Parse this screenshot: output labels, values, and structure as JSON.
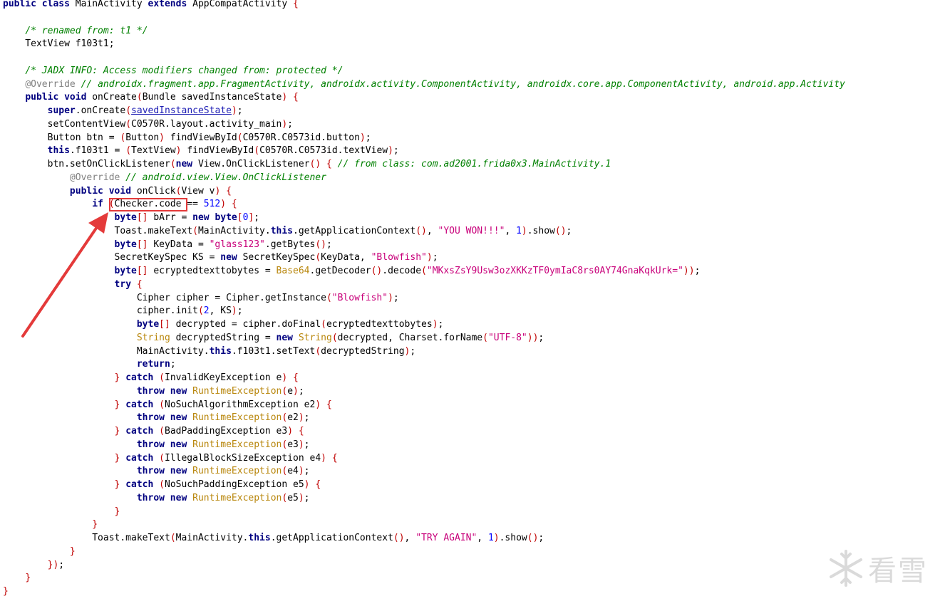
{
  "code_lines": [
    [
      [
        "kw",
        "public class "
      ],
      [
        "",
        "MainActivity "
      ],
      [
        "kw",
        "extends "
      ],
      [
        "",
        "AppCompatActivity "
      ],
      [
        "br",
        "{"
      ]
    ],
    [],
    [
      [
        "",
        "    "
      ],
      [
        "cm",
        "/* renamed from: t1 */"
      ]
    ],
    [
      [
        "",
        "    TextView f103t1;"
      ]
    ],
    [],
    [
      [
        "",
        "    "
      ],
      [
        "cm",
        "/* JADX INFO: Access modifiers changed from: protected */"
      ]
    ],
    [
      [
        "",
        "    "
      ],
      [
        "an",
        "@Override "
      ],
      [
        "cm",
        "// androidx.fragment.app.FragmentActivity, androidx.activity.ComponentActivity, androidx.core.app.ComponentActivity, android.app.Activity"
      ]
    ],
    [
      [
        "",
        "    "
      ],
      [
        "kw",
        "public void "
      ],
      [
        "",
        "onCreate"
      ],
      [
        "br",
        "("
      ],
      [
        "",
        "Bundle savedInstanceState"
      ],
      [
        "br",
        ")"
      ],
      [
        "",
        " "
      ],
      [
        "br",
        "{"
      ]
    ],
    [
      [
        "",
        "        "
      ],
      [
        "kw",
        "super"
      ],
      [
        "",
        ".onCreate"
      ],
      [
        "br",
        "("
      ],
      [
        "lk",
        "savedInstanceState"
      ],
      [
        "br",
        ")"
      ],
      [
        "",
        ";"
      ]
    ],
    [
      [
        "",
        "        setContentView"
      ],
      [
        "br",
        "("
      ],
      [
        "",
        "C0570R.layout.activity_main"
      ],
      [
        "br",
        ")"
      ],
      [
        "",
        ";"
      ]
    ],
    [
      [
        "",
        "        Button btn = "
      ],
      [
        "br",
        "("
      ],
      [
        "",
        "Button"
      ],
      [
        "br",
        ")"
      ],
      [
        "",
        " findViewById"
      ],
      [
        "br",
        "("
      ],
      [
        "",
        "C0570R.C0573id.button"
      ],
      [
        "br",
        ")"
      ],
      [
        "",
        ";"
      ]
    ],
    [
      [
        "",
        "        "
      ],
      [
        "kw",
        "this"
      ],
      [
        "",
        ".f103t1 = "
      ],
      [
        "br",
        "("
      ],
      [
        "",
        "TextView"
      ],
      [
        "br",
        ")"
      ],
      [
        "",
        " findViewById"
      ],
      [
        "br",
        "("
      ],
      [
        "",
        "C0570R.C0573id.textView"
      ],
      [
        "br",
        ")"
      ],
      [
        "",
        ";"
      ]
    ],
    [
      [
        "",
        "        btn.setOnClickListener"
      ],
      [
        "br",
        "("
      ],
      [
        "kw",
        "new "
      ],
      [
        "",
        "View.OnClickListener"
      ],
      [
        "br",
        "()"
      ],
      [
        "",
        " "
      ],
      [
        "br",
        "{"
      ],
      [
        "",
        " "
      ],
      [
        "cm",
        "// from class: com.ad2001.frida0x3.MainActivity.1"
      ]
    ],
    [
      [
        "",
        "            "
      ],
      [
        "an",
        "@Override "
      ],
      [
        "cm",
        "// android.view.View.OnClickListener"
      ]
    ],
    [
      [
        "",
        "            "
      ],
      [
        "kw",
        "public void "
      ],
      [
        "",
        "onClick"
      ],
      [
        "br",
        "("
      ],
      [
        "",
        "View v"
      ],
      [
        "br",
        ")"
      ],
      [
        "",
        " "
      ],
      [
        "br",
        "{"
      ]
    ],
    [
      [
        "",
        "                "
      ],
      [
        "kw",
        "if "
      ],
      [
        "br",
        "("
      ],
      [
        "",
        "Checker.code == "
      ],
      [
        "nm",
        "512"
      ],
      [
        "br",
        ")"
      ],
      [
        "",
        " "
      ],
      [
        "br",
        "{"
      ]
    ],
    [
      [
        "",
        "                    "
      ],
      [
        "kw",
        "byte"
      ],
      [
        "br",
        "[]"
      ],
      [
        "",
        " bArr = "
      ],
      [
        "kw",
        "new byte"
      ],
      [
        "br",
        "["
      ],
      [
        "nm",
        "0"
      ],
      [
        "br",
        "]"
      ],
      [
        "",
        ";"
      ]
    ],
    [
      [
        "",
        "                    Toast.makeText"
      ],
      [
        "br",
        "("
      ],
      [
        "",
        "MainActivity."
      ],
      [
        "kw",
        "this"
      ],
      [
        "",
        ".getApplicationContext"
      ],
      [
        "br",
        "()"
      ],
      [
        "",
        ", "
      ],
      [
        "st",
        "\"YOU WON!!!\""
      ],
      [
        "",
        ", "
      ],
      [
        "nm",
        "1"
      ],
      [
        "br",
        ")"
      ],
      [
        "",
        ".show"
      ],
      [
        "br",
        "()"
      ],
      [
        "",
        ";"
      ]
    ],
    [
      [
        "",
        "                    "
      ],
      [
        "kw",
        "byte"
      ],
      [
        "br",
        "[]"
      ],
      [
        "",
        " KeyData = "
      ],
      [
        "st",
        "\"glass123\""
      ],
      [
        "",
        ".getBytes"
      ],
      [
        "br",
        "()"
      ],
      [
        "",
        ";"
      ]
    ],
    [
      [
        "",
        "                    SecretKeySpec KS = "
      ],
      [
        "kw",
        "new "
      ],
      [
        "",
        "SecretKeySpec"
      ],
      [
        "br",
        "("
      ],
      [
        "",
        "KeyData, "
      ],
      [
        "st",
        "\"Blowfish\""
      ],
      [
        "br",
        ")"
      ],
      [
        "",
        ";"
      ]
    ],
    [
      [
        "",
        "                    "
      ],
      [
        "kw",
        "byte"
      ],
      [
        "br",
        "[]"
      ],
      [
        "",
        " ecryptedtexttobytes = "
      ],
      [
        "ty",
        "Base64"
      ],
      [
        "",
        ".getDecoder"
      ],
      [
        "br",
        "()"
      ],
      [
        "",
        ".decode"
      ],
      [
        "br",
        "("
      ],
      [
        "st",
        "\"MKxsZsY9Usw3ozXKKzTF0ymIaC8rs0AY74GnaKqkUrk=\""
      ],
      [
        "br",
        "))"
      ],
      [
        "",
        ";"
      ]
    ],
    [
      [
        "",
        "                    "
      ],
      [
        "kw",
        "try "
      ],
      [
        "br",
        "{"
      ]
    ],
    [
      [
        "",
        "                        Cipher cipher = Cipher.getInstance"
      ],
      [
        "br",
        "("
      ],
      [
        "st",
        "\"Blowfish\""
      ],
      [
        "br",
        ")"
      ],
      [
        "",
        ";"
      ]
    ],
    [
      [
        "",
        "                        cipher.init"
      ],
      [
        "br",
        "("
      ],
      [
        "nm",
        "2"
      ],
      [
        "",
        ", KS"
      ],
      [
        "br",
        ")"
      ],
      [
        "",
        ";"
      ]
    ],
    [
      [
        "",
        "                        "
      ],
      [
        "kw",
        "byte"
      ],
      [
        "br",
        "[]"
      ],
      [
        "",
        " decrypted = cipher.doFinal"
      ],
      [
        "br",
        "("
      ],
      [
        "",
        "ecryptedtexttobytes"
      ],
      [
        "br",
        ")"
      ],
      [
        "",
        ";"
      ]
    ],
    [
      [
        "",
        "                        "
      ],
      [
        "ty",
        "String"
      ],
      [
        "",
        " decryptedString = "
      ],
      [
        "kw",
        "new "
      ],
      [
        "ty",
        "String"
      ],
      [
        "br",
        "("
      ],
      [
        "",
        "decrypted, Charset.forName"
      ],
      [
        "br",
        "("
      ],
      [
        "st",
        "\"UTF-8\""
      ],
      [
        "br",
        "))"
      ],
      [
        "",
        ";"
      ]
    ],
    [
      [
        "",
        "                        MainActivity."
      ],
      [
        "kw",
        "this"
      ],
      [
        "",
        ".f103t1.setText"
      ],
      [
        "br",
        "("
      ],
      [
        "",
        "decryptedString"
      ],
      [
        "br",
        ")"
      ],
      [
        "",
        ";"
      ]
    ],
    [
      [
        "",
        "                        "
      ],
      [
        "kw",
        "return"
      ],
      [
        "",
        ";"
      ]
    ],
    [
      [
        "",
        "                    "
      ],
      [
        "br",
        "}"
      ],
      [
        "",
        " "
      ],
      [
        "kw",
        "catch "
      ],
      [
        "br",
        "("
      ],
      [
        "",
        "InvalidKeyException e"
      ],
      [
        "br",
        ")"
      ],
      [
        "",
        " "
      ],
      [
        "br",
        "{"
      ]
    ],
    [
      [
        "",
        "                        "
      ],
      [
        "kw",
        "throw new "
      ],
      [
        "ty",
        "RuntimeException"
      ],
      [
        "br",
        "("
      ],
      [
        "",
        "e"
      ],
      [
        "br",
        ")"
      ],
      [
        "",
        ";"
      ]
    ],
    [
      [
        "",
        "                    "
      ],
      [
        "br",
        "}"
      ],
      [
        "",
        " "
      ],
      [
        "kw",
        "catch "
      ],
      [
        "br",
        "("
      ],
      [
        "",
        "NoSuchAlgorithmException e2"
      ],
      [
        "br",
        ")"
      ],
      [
        "",
        " "
      ],
      [
        "br",
        "{"
      ]
    ],
    [
      [
        "",
        "                        "
      ],
      [
        "kw",
        "throw new "
      ],
      [
        "ty",
        "RuntimeException"
      ],
      [
        "br",
        "("
      ],
      [
        "",
        "e2"
      ],
      [
        "br",
        ")"
      ],
      [
        "",
        ";"
      ]
    ],
    [
      [
        "",
        "                    "
      ],
      [
        "br",
        "}"
      ],
      [
        "",
        " "
      ],
      [
        "kw",
        "catch "
      ],
      [
        "br",
        "("
      ],
      [
        "",
        "BadPaddingException e3"
      ],
      [
        "br",
        ")"
      ],
      [
        "",
        " "
      ],
      [
        "br",
        "{"
      ]
    ],
    [
      [
        "",
        "                        "
      ],
      [
        "kw",
        "throw new "
      ],
      [
        "ty",
        "RuntimeException"
      ],
      [
        "br",
        "("
      ],
      [
        "",
        "e3"
      ],
      [
        "br",
        ")"
      ],
      [
        "",
        ";"
      ]
    ],
    [
      [
        "",
        "                    "
      ],
      [
        "br",
        "}"
      ],
      [
        "",
        " "
      ],
      [
        "kw",
        "catch "
      ],
      [
        "br",
        "("
      ],
      [
        "",
        "IllegalBlockSizeException e4"
      ],
      [
        "br",
        ")"
      ],
      [
        "",
        " "
      ],
      [
        "br",
        "{"
      ]
    ],
    [
      [
        "",
        "                        "
      ],
      [
        "kw",
        "throw new "
      ],
      [
        "ty",
        "RuntimeException"
      ],
      [
        "br",
        "("
      ],
      [
        "",
        "e4"
      ],
      [
        "br",
        ")"
      ],
      [
        "",
        ";"
      ]
    ],
    [
      [
        "",
        "                    "
      ],
      [
        "br",
        "}"
      ],
      [
        "",
        " "
      ],
      [
        "kw",
        "catch "
      ],
      [
        "br",
        "("
      ],
      [
        "",
        "NoSuchPaddingException e5"
      ],
      [
        "br",
        ")"
      ],
      [
        "",
        " "
      ],
      [
        "br",
        "{"
      ]
    ],
    [
      [
        "",
        "                        "
      ],
      [
        "kw",
        "throw new "
      ],
      [
        "ty",
        "RuntimeException"
      ],
      [
        "br",
        "("
      ],
      [
        "",
        "e5"
      ],
      [
        "br",
        ")"
      ],
      [
        "",
        ";"
      ]
    ],
    [
      [
        "",
        "                    "
      ],
      [
        "br",
        "}"
      ]
    ],
    [
      [
        "",
        "                "
      ],
      [
        "br",
        "}"
      ]
    ],
    [
      [
        "",
        "                Toast.makeText"
      ],
      [
        "br",
        "("
      ],
      [
        "",
        "MainActivity."
      ],
      [
        "kw",
        "this"
      ],
      [
        "",
        ".getApplicationContext"
      ],
      [
        "br",
        "()"
      ],
      [
        "",
        ", "
      ],
      [
        "st",
        "\"TRY AGAIN\""
      ],
      [
        "",
        ", "
      ],
      [
        "nm",
        "1"
      ],
      [
        "br",
        ")"
      ],
      [
        "",
        ".show"
      ],
      [
        "br",
        "()"
      ],
      [
        "",
        ";"
      ]
    ],
    [
      [
        "",
        "            "
      ],
      [
        "br",
        "}"
      ]
    ],
    [
      [
        "",
        "        "
      ],
      [
        "br",
        "})"
      ],
      [
        "",
        ";"
      ]
    ],
    [
      [
        "",
        "    "
      ],
      [
        "br",
        "}"
      ]
    ],
    [
      [
        "br",
        "}"
      ]
    ]
  ],
  "annotation": {
    "highlighted_text": "Checker.code",
    "box_color": "#e43a3a",
    "arrow_color": "#e43a3a"
  },
  "watermark": {
    "text": "看雪",
    "icon": "snowflake-icon",
    "color": "#d4d4d4"
  }
}
